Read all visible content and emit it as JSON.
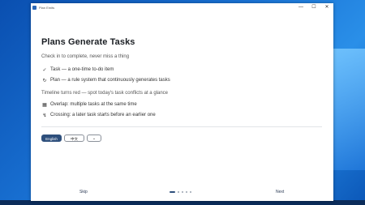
{
  "window": {
    "title": "Plan Emits",
    "controls": {
      "minimize": "—",
      "maximize": "☐",
      "close": "✕"
    }
  },
  "page": {
    "title": "Plans Generate Tasks",
    "subtitle": "Check in to complete, never miss a thing",
    "items": [
      {
        "icon": "check-circle-icon",
        "glyph": "✓",
        "text": "Task — a one-time to-do item"
      },
      {
        "icon": "refresh-icon",
        "glyph": "↻",
        "text": "Plan — a rule system that continuously generates tasks"
      }
    ],
    "section2": "Timeline turns red — spot today's task conflicts at a glance",
    "conflicts": [
      {
        "icon": "calendar-icon",
        "glyph": "▦",
        "text": "Overlap: multiple tasks at the same time"
      },
      {
        "icon": "crossing-arrows-icon",
        "glyph": "↯",
        "text": "Crossing: a later task starts before an earlier one"
      }
    ]
  },
  "language": {
    "options": [
      "English",
      "中文"
    ],
    "selected": "English",
    "dropdown_glyph": "⌄"
  },
  "footer": {
    "skip": "Skip",
    "next": "Next",
    "pages": 5,
    "current": 1
  },
  "colors": {
    "accent": "#2e4f7c",
    "desktop": "#1a74d6"
  }
}
